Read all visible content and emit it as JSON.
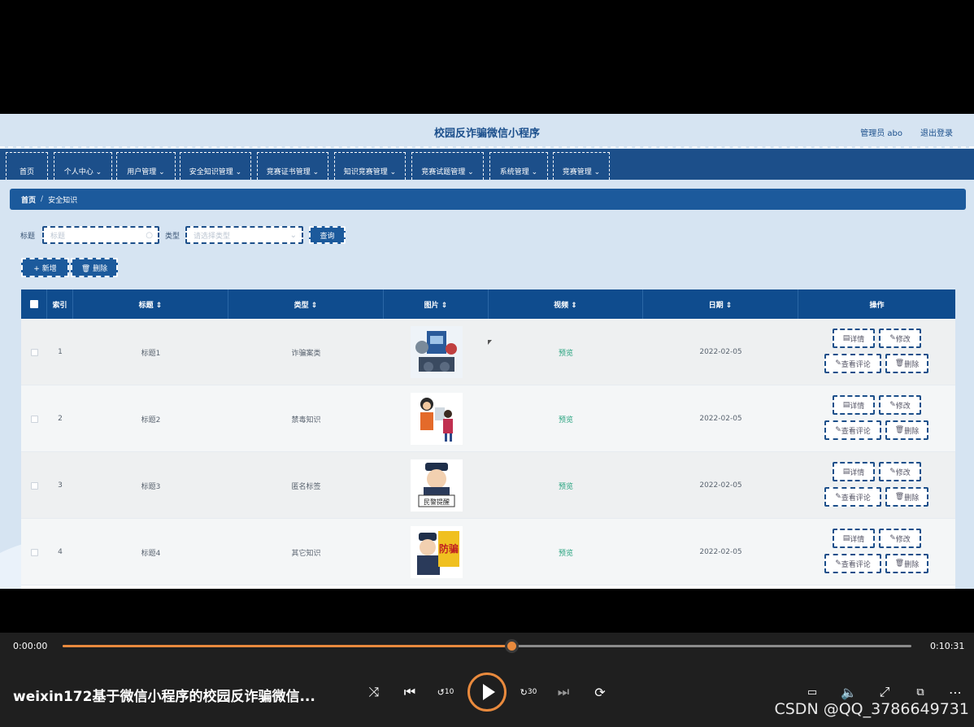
{
  "app": {
    "title": "校园反诈骗微信小程序",
    "user": "管理员 abo",
    "logout": "退出登录"
  },
  "nav": [
    {
      "label": "首页"
    },
    {
      "label": "个人中心 ⌄"
    },
    {
      "label": "用户管理 ⌄"
    },
    {
      "label": "安全知识管理 ⌄"
    },
    {
      "label": "竞赛证书管理 ⌄"
    },
    {
      "label": "知识竞赛管理 ⌄"
    },
    {
      "label": "竞赛试题管理 ⌄"
    },
    {
      "label": "系统管理 ⌄"
    },
    {
      "label": "竞赛管理 ⌄"
    }
  ],
  "breadcrumb": {
    "home": "首页",
    "sep": "/",
    "current": "安全知识"
  },
  "search": {
    "title_label": "标题",
    "title_placeholder": "标题",
    "type_label": "类型",
    "type_placeholder": "请选择类型",
    "query_button": "查询"
  },
  "toolbar": {
    "add_button": "+ 新增",
    "delete_button": "🗑 删除"
  },
  "table": {
    "headers": [
      "",
      "索引",
      "标题 ⇕",
      "类型 ⇕",
      "图片 ⇕",
      "视频 ⇕",
      "日期 ⇕",
      "操作"
    ],
    "rows": [
      {
        "index": "1",
        "title": "标题1",
        "type": "诈骗案类",
        "video": "预览",
        "date": "2022-02-05"
      },
      {
        "index": "2",
        "title": "标题2",
        "type": "禁毒知识",
        "video": "预览",
        "date": "2022-02-05"
      },
      {
        "index": "3",
        "title": "标题3",
        "type": "匿名标签",
        "video": "预览",
        "date": "2022-02-05"
      },
      {
        "index": "4",
        "title": "标题4",
        "type": "其它知识",
        "video": "预览",
        "date": "2022-02-05"
      }
    ],
    "actions": {
      "detail": "详情",
      "edit": "修改",
      "comments": "查看评论",
      "delete": "删除"
    },
    "thumb_texts": {
      "row3": "民警提醒",
      "row4": "防骗"
    }
  },
  "player": {
    "current_time": "0:00:00",
    "total_time": "0:10:31",
    "progress": 0.53,
    "video_title": "weixin172基于微信小程序的校园反诈骗微信...",
    "skip_back": "10",
    "skip_forward": "30",
    "accent": "#e98a3d"
  },
  "watermark": "CSDN @QQ_3786649731"
}
